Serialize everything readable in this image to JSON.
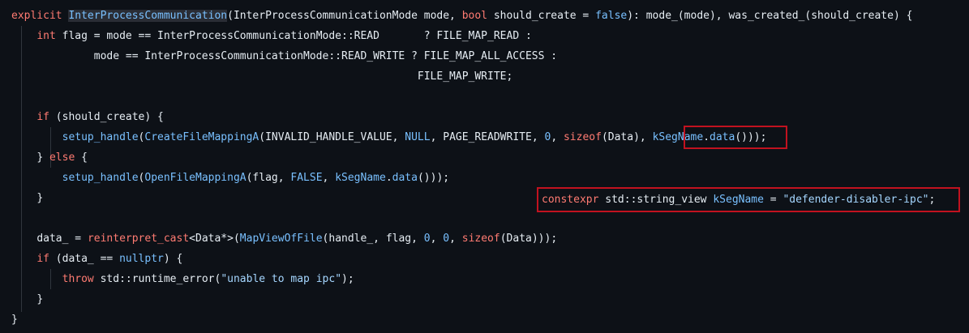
{
  "lines": {
    "l1": {
      "explicit": "explicit",
      "fname": "InterProcessCommunication",
      "open": "(InterProcessCommunicationMode mode, ",
      "bool": "bool",
      "mid": " should_create = ",
      "false": "false",
      "rest": "): mode_(mode), was_created_(should_create) {"
    },
    "l2": {
      "int": "int",
      "rest": " flag = mode == InterProcessCommunicationMode::READ       ? FILE_MAP_READ :"
    },
    "l3": {
      "text": "             mode == InterProcessCommunicationMode::READ_WRITE ? FILE_MAP_ALL_ACCESS :"
    },
    "l4": {
      "text": "                                                                FILE_MAP_WRITE;"
    },
    "l5": {
      "if": "if",
      "rest": " (should_create) {"
    },
    "l6": {
      "setup": "setup_handle",
      "p1": "(",
      "create": "CreateFileMappingA",
      "p2": "(INVALID_HANDLE_VALUE, ",
      "null": "NULL",
      "p3": ", PAGE_READWRITE, ",
      "zero": "0",
      "p4": ", ",
      "sizeof": "sizeof",
      "p5": "(Data), ",
      "ksegname": "kSegName",
      "dot": ".",
      "data": "data",
      "p6": "()",
      "p7": "));"
    },
    "l7": {
      "text": "} ",
      "else": "else",
      "rest": " {"
    },
    "l8": {
      "setup": "setup_handle",
      "p1": "(",
      "open": "OpenFileMappingA",
      "p2": "(flag, ",
      "false": "FALSE",
      "p3": ", ",
      "ksegname": "kSegName",
      "dot": ".",
      "data": "data",
      "p4": "()));"
    },
    "l9": {
      "text": "}"
    },
    "l10": {
      "pre": "data_ = ",
      "cast": "reinterpret_cast",
      "type": "<Data*>",
      "p1": "(",
      "mapview": "MapViewOfFile",
      "p2": "(handle_, flag, ",
      "z1": "0",
      "c1": ", ",
      "z2": "0",
      "c2": ", ",
      "sizeof": "sizeof",
      "p3": "(Data)));"
    },
    "l11": {
      "if": "if",
      "mid": " (data_ == ",
      "nullptr": "nullptr",
      "rest": ") {"
    },
    "l12": {
      "throw": "throw",
      "mid": " std::runtime_error(",
      "str": "\"unable to map ipc\"",
      "rest": ");"
    },
    "l13": {
      "text": "}"
    },
    "l14": {
      "text": "}"
    }
  },
  "callout": {
    "constexpr": "constexpr",
    "mid": " std::string_view ",
    "name": "kSegName",
    "eq": " = ",
    "str": "\"defender-disabler-ipc\"",
    "end": ";"
  },
  "colors": {
    "background": "#0d1117",
    "keyword": "#ff7b72",
    "function": "#79c0ff",
    "string": "#a5d6ff",
    "highlight_box": "#c1121f"
  }
}
